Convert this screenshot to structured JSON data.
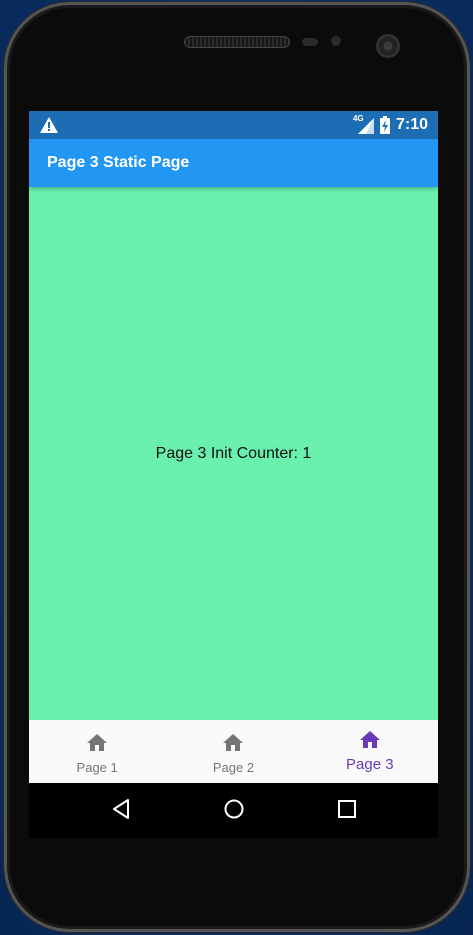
{
  "status_bar": {
    "alert_icon": "warning-icon",
    "network": "4G",
    "signal_icon": "cell-signal-icon",
    "battery_icon": "battery-charging-icon",
    "time": "7:10"
  },
  "app_bar": {
    "title": "Page 3 Static Page",
    "color": "#2196f3"
  },
  "content": {
    "text": "Page 3 Init Counter: 1",
    "background": "#69f0ae"
  },
  "bottom_nav": {
    "items": [
      {
        "label": "Page 1",
        "icon": "home-icon",
        "active": false
      },
      {
        "label": "Page 2",
        "icon": "home-icon",
        "active": false
      },
      {
        "label": "Page 3",
        "icon": "home-icon",
        "active": true
      }
    ],
    "active_color": "#673ab7",
    "inactive_color": "#757575"
  },
  "system_nav": {
    "back": "back-icon",
    "home": "circle-home-icon",
    "recents": "recents-icon"
  }
}
